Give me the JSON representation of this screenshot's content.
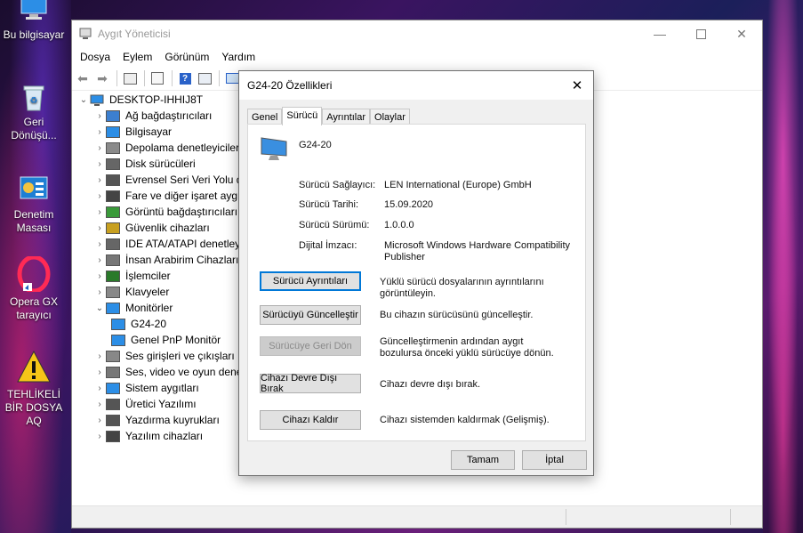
{
  "desktop": {
    "icons": [
      {
        "label": "Bu bilgisayar",
        "icon": "this-pc-icon"
      },
      {
        "label": "Geri Dönüşü...",
        "icon": "recycle-bin-icon"
      },
      {
        "label": "Denetim Masası",
        "icon": "control-panel-icon"
      },
      {
        "label": "Opera GX tarayıcı",
        "icon": "opera-gx-icon"
      },
      {
        "label": "TEHLİKELİ BİR DOSYA AQ",
        "icon": "warning-icon"
      }
    ]
  },
  "window": {
    "title": "Aygıt Yöneticisi",
    "menu": [
      "Dosya",
      "Eylem",
      "Görünüm",
      "Yardım"
    ],
    "tree": {
      "root": "DESKTOP-IHHIJ8T",
      "items": [
        {
          "label": "Ağ bağdaştırıcıları",
          "expanded": false
        },
        {
          "label": "Bilgisayar",
          "expanded": false
        },
        {
          "label": "Depolama denetleyiciler",
          "expanded": false
        },
        {
          "label": "Disk sürücüleri",
          "expanded": false
        },
        {
          "label": "Evrensel Seri Veri Yolu de",
          "expanded": false
        },
        {
          "label": "Fare ve diğer işaret aygıt",
          "expanded": false
        },
        {
          "label": "Görüntü bağdaştırıcıları",
          "expanded": false
        },
        {
          "label": "Güvenlik cihazları",
          "expanded": false
        },
        {
          "label": "IDE ATA/ATAPI denetleyi",
          "expanded": false
        },
        {
          "label": "İnsan Arabirim Cihazları",
          "expanded": false
        },
        {
          "label": "İşlemciler",
          "expanded": false
        },
        {
          "label": "Klavyeler",
          "expanded": false
        },
        {
          "label": "Monitörler",
          "expanded": true
        },
        {
          "label": "G24-20",
          "child": true
        },
        {
          "label": "Genel PnP Monitör",
          "child": true
        },
        {
          "label": "Ses girişleri ve çıkışları",
          "expanded": false
        },
        {
          "label": "Ses, video ve oyun dene",
          "expanded": false
        },
        {
          "label": "Sistem aygıtları",
          "expanded": false
        },
        {
          "label": "Üretici Yazılımı",
          "expanded": false
        },
        {
          "label": "Yazdırma kuyrukları",
          "expanded": false
        },
        {
          "label": "Yazılım cihazları",
          "expanded": false
        }
      ]
    }
  },
  "dialog": {
    "title": "G24-20 Özellikleri",
    "tabs": [
      "Genel",
      "Sürücü",
      "Ayrıntılar",
      "Olaylar"
    ],
    "active_tab": "Sürücü",
    "device_name": "G24-20",
    "fields": [
      {
        "label": "Sürücü Sağlayıcı:",
        "value": "LEN International (Europe) GmbH"
      },
      {
        "label": "Sürücü Tarihi:",
        "value": "15.09.2020"
      },
      {
        "label": "Sürücü Sürümü:",
        "value": "1.0.0.0"
      },
      {
        "label": "Dijital İmzacı:",
        "value": "Microsoft Windows Hardware Compatibility Publisher"
      }
    ],
    "actions": [
      {
        "button": "Sürücü Ayrıntıları",
        "desc": "Yüklü sürücü dosyalarının ayrıntılarını görüntüleyin."
      },
      {
        "button": "Sürücüyü Güncelleştir",
        "desc": "Bu cihazın sürücüsünü güncelleştir."
      },
      {
        "button": "Sürücüye Geri Dön",
        "desc": "Güncelleştirmenin ardından aygıt bozulursa önceki yüklü sürücüye dönün."
      },
      {
        "button": "Cihazı Devre Dışı Bırak",
        "desc": "Cihazı devre dışı bırak."
      },
      {
        "button": "Cihazı Kaldır",
        "desc": "Cihazı sistemden kaldırmak (Gelişmiş)."
      }
    ],
    "ok": "Tamam",
    "cancel": "İptal"
  }
}
